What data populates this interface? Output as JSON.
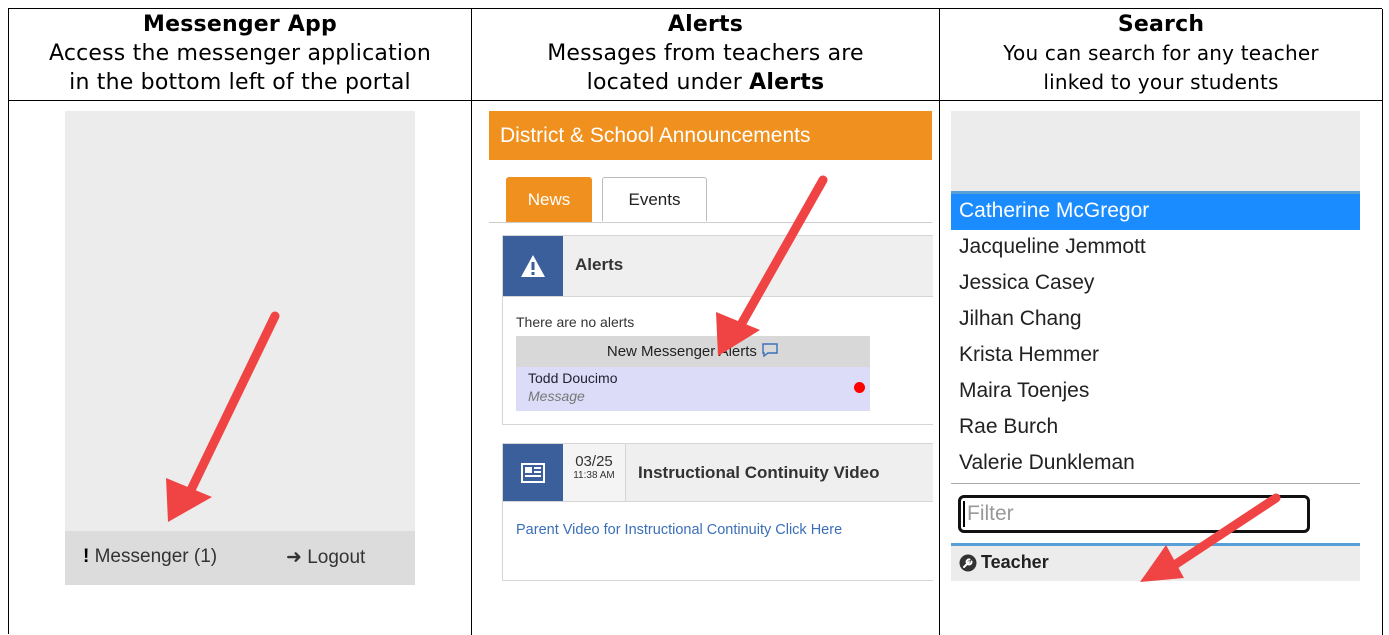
{
  "columns": [
    {
      "title": "Messenger App",
      "line1": "Access the messenger application",
      "line2": "in the bottom left of the portal"
    },
    {
      "title": "Alerts",
      "line1": "Messages from teachers are",
      "line2_prefix": "located under ",
      "line2_bold": "Alerts"
    },
    {
      "title": "Search",
      "line1": "You can search for any teacher",
      "line2": "linked to your students"
    }
  ],
  "portal": {
    "messenger_mark": "!",
    "messenger_label": "Messenger (1)",
    "logout_label": "Logout"
  },
  "announcements": {
    "header": "District & School Announcements",
    "tabs": [
      "News",
      "Events"
    ],
    "alerts_title": "Alerts",
    "no_alerts": "There are no alerts",
    "messenger_alerts_header": "New Messenger Alerts",
    "alert_sender": "Todd Doucimo",
    "alert_sub": "Message",
    "item_date": "03/25",
    "item_time": "11:38 AM",
    "item_title": "Instructional Continuity Video",
    "item_link": "Parent Video for Instructional Continuity Click Here"
  },
  "search": {
    "teachers": [
      "Catherine McGregor",
      "Jacqueline Jemmott",
      "Jessica Casey",
      "Jilhan Chang",
      "Krista Hemmer",
      "Maira Toenjes",
      "Rae Burch",
      "Valerie Dunkleman"
    ],
    "selected": "Catherine McGregor",
    "filter_placeholder": "Filter",
    "category": "Teacher"
  },
  "colors": {
    "orange": "#f0901e",
    "blue_icon": "#3a5f9a",
    "selected_blue": "#1a8cff",
    "arrow_red": "#f04444"
  }
}
